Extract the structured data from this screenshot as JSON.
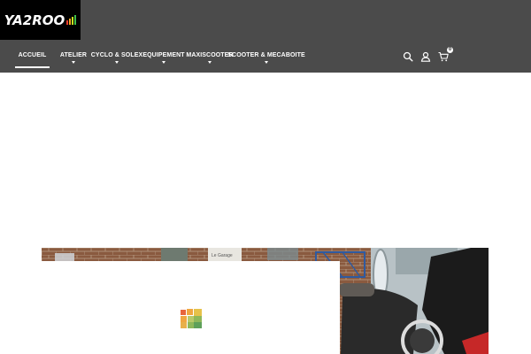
{
  "brand": {
    "logo_text": "YA2ROO",
    "bar_colors": [
      "#e63b2e",
      "#f5a623",
      "#c7e21f",
      "#3fbf4a"
    ]
  },
  "nav": {
    "items": [
      {
        "label": "ACCUEIL",
        "active": true,
        "dropdown": false
      },
      {
        "label": "ATELIER",
        "active": false,
        "dropdown": true
      },
      {
        "label": "CYCLO & SOLEX",
        "active": false,
        "dropdown": true
      },
      {
        "label": "EQUIPEMENT",
        "active": false,
        "dropdown": true
      },
      {
        "label": "MAXISCOOTER",
        "active": false,
        "dropdown": true
      },
      {
        "label": "SCOOTER & MECABOITE",
        "active": false,
        "dropdown": true
      }
    ]
  },
  "tools": {
    "icons": [
      "search-icon",
      "user-icon",
      "cart-icon"
    ],
    "cart_count": "0"
  },
  "hero": {
    "sign_text": "Le Garage"
  },
  "loader": {
    "icon": "loading-squares-icon",
    "colors": [
      "#e8643c",
      "#f0a640",
      "#e6c24a",
      "#8fb85a",
      "#5ea05a",
      "#b9c96a"
    ]
  },
  "colors": {
    "header_bg": "#4b4b4b",
    "logo_bg": "#000000",
    "nav_text": "#ffffff",
    "page_bg": "#ffffff"
  }
}
